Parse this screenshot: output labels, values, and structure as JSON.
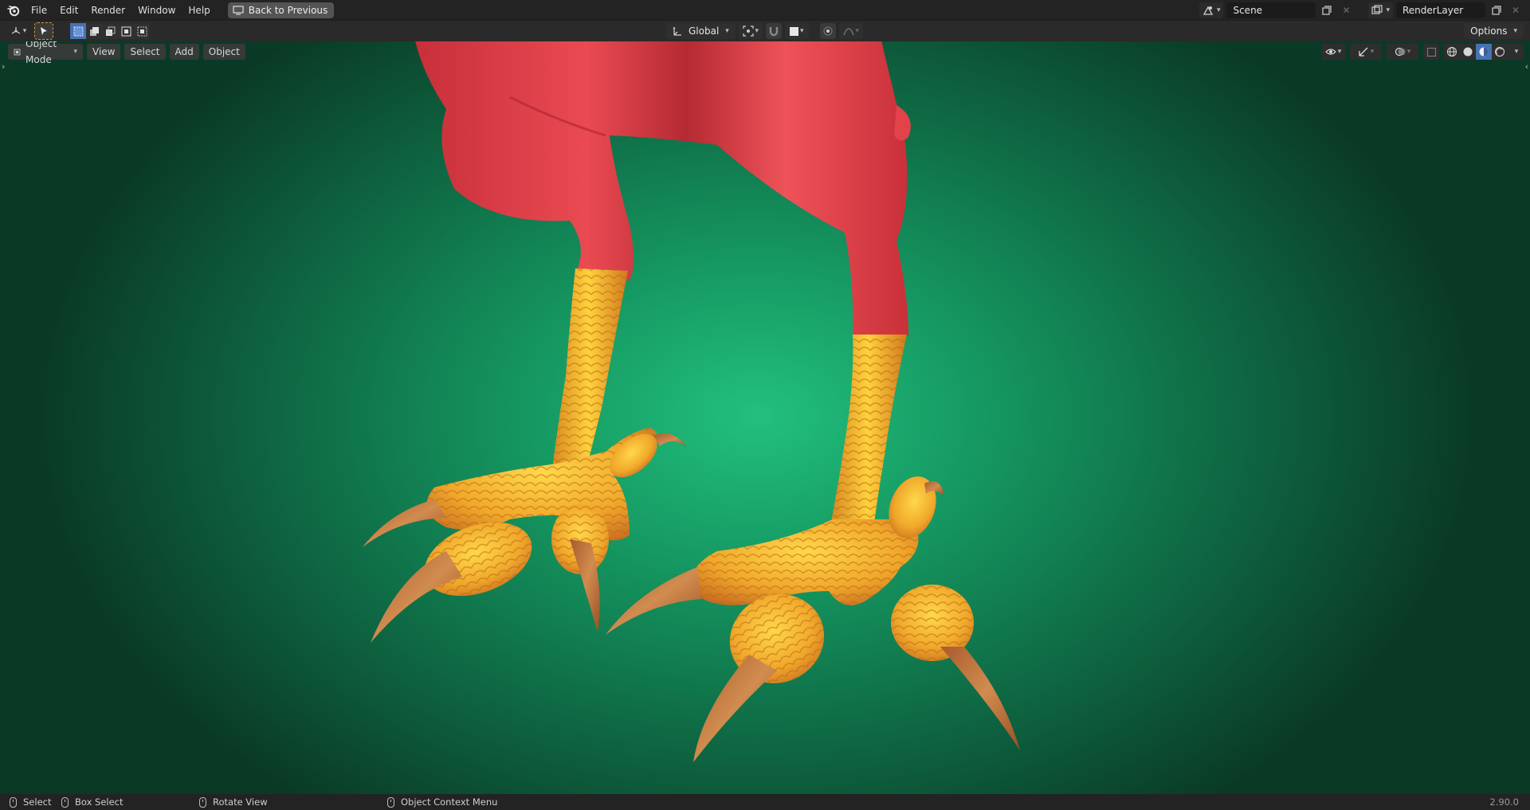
{
  "topbar": {
    "logo_icon": "blender-logo-icon",
    "menus": [
      "File",
      "Edit",
      "Render",
      "Window",
      "Help"
    ],
    "back_label": "Back to Previous",
    "scene_name": "Scene",
    "render_layer": "RenderLayer"
  },
  "toolbar": {
    "orientation": "Global",
    "options_label": "Options"
  },
  "viewport_header": {
    "mode": "Object Mode",
    "menus": [
      "View",
      "Select",
      "Add",
      "Object"
    ]
  },
  "statusbar": {
    "select": "Select",
    "box_select": "Box Select",
    "rotate_view": "Rotate View",
    "context_menu": "Object Context Menu",
    "version": "2.90.0"
  },
  "colors": {
    "accent": "#4772b3",
    "viewport_center": "#22c07e",
    "viewport_edge": "#0a3a26",
    "body_red": "#e8454c",
    "feet_yellow": "#f4b52a",
    "claw_brown": "#b86a35"
  }
}
